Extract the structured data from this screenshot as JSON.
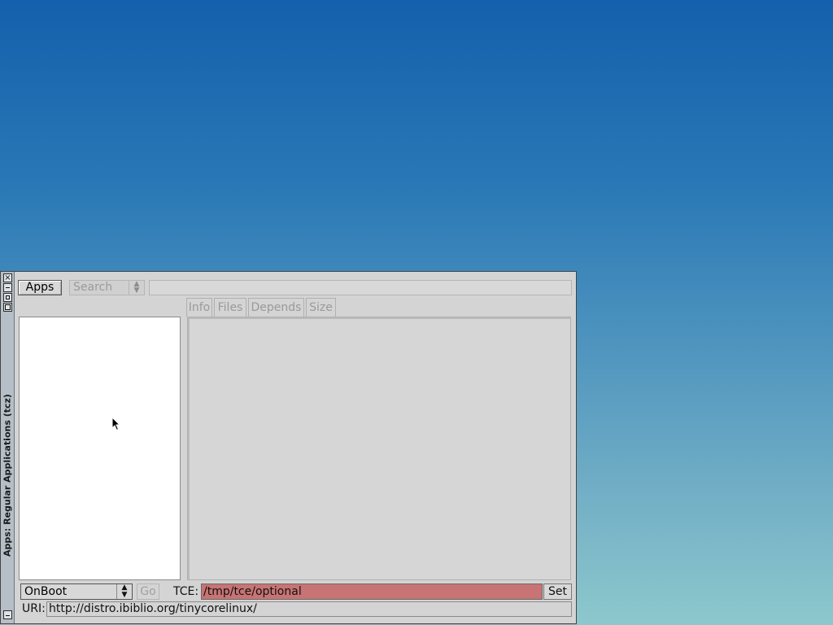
{
  "window": {
    "title": "Apps: Regular Applications (tcz)",
    "buttons": {
      "close": "×"
    }
  },
  "toolbar": {
    "apps_label": "Apps",
    "search_mode": "Search",
    "search_value": ""
  },
  "tabs": [
    {
      "label": "Info"
    },
    {
      "label": "Files"
    },
    {
      "label": "Depends"
    },
    {
      "label": "Size"
    }
  ],
  "active_tab": "Files",
  "footer": {
    "onboot_option": "OnBoot",
    "go_label": "Go",
    "tce_label": "TCE:",
    "tce_value": "/tmp/tce/optional",
    "set_label": "Set",
    "uri_label": "URI:",
    "uri_value": "http://distro.ibiblio.org/tinycorelinux/"
  },
  "colors": {
    "tce_field_bg": "#c87474",
    "desktop_top": "#1460ac",
    "desktop_bottom": "#8cc8cc"
  },
  "icons": {
    "cursor": "arrow-cursor-icon",
    "select_arrows": "up-down-arrows-icon"
  }
}
